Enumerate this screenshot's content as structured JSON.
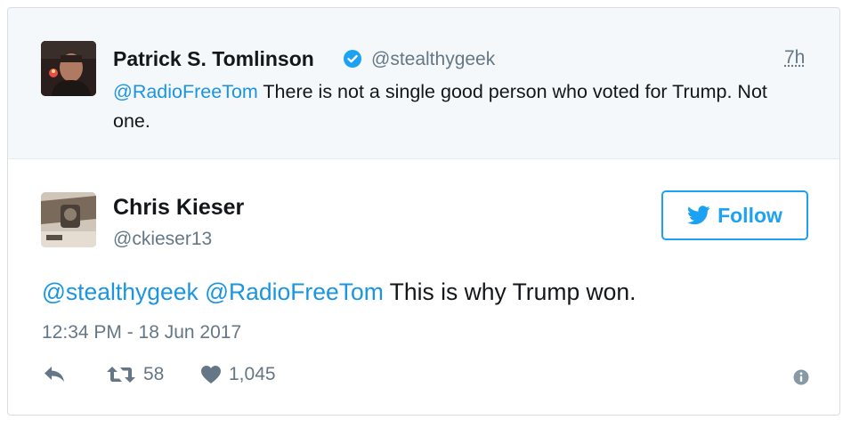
{
  "quoted_tweet": {
    "author_name": "Patrick S. Tomlinson",
    "handle": "@stealthygeek",
    "time": "7h",
    "mention": "@RadioFreeTom",
    "text": " There is not a single good person who voted for Trump. Not one.",
    "verified": true
  },
  "main_tweet": {
    "author_name": "Chris Kieser",
    "handle": "@ckieser13",
    "follow_label": "Follow",
    "mention_1": "@stealthygeek",
    "mention_2": "@RadioFreeTom",
    "text": "This is why Trump won.",
    "timestamp": "12:34 PM - 18 Jun 2017",
    "retweets": "58",
    "likes": "1,045"
  },
  "colors": {
    "link": "#1b95e0",
    "follow": "#1da1f2",
    "muted": "#657786",
    "quoted_bg": "#f5f8fa"
  },
  "icons": [
    "verified-badge-icon",
    "twitter-bird-icon",
    "reply-icon",
    "retweet-icon",
    "heart-icon",
    "info-icon"
  ]
}
